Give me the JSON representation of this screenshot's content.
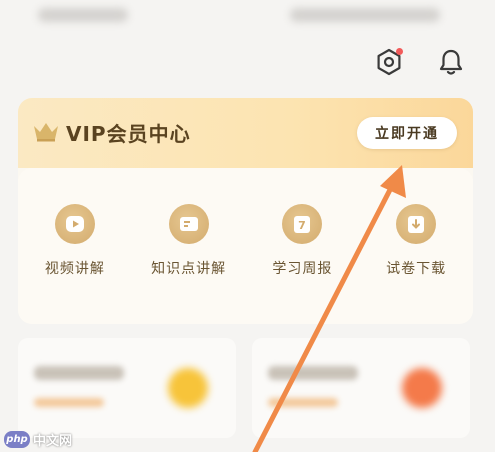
{
  "header": {
    "settings_icon": "settings-hexagon-icon",
    "notification_icon": "bell-icon",
    "accent_dot_color": "#f25a5a"
  },
  "vip": {
    "title": "VIP会员中心",
    "open_button": "立即开通",
    "crown_icon": "crown-icon",
    "header_gradient": [
      "#fbe9c3",
      "#fbd79a"
    ],
    "features": [
      {
        "label": "视频讲解",
        "icon": "play-icon"
      },
      {
        "label": "知识点讲解",
        "icon": "card-list-icon"
      },
      {
        "label": "学习周报",
        "icon": "calendar-7-icon"
      },
      {
        "label": "试卷下载",
        "icon": "download-icon"
      }
    ]
  },
  "annotation": {
    "arrow_color": "#f08a48",
    "pointing_to": "open-vip-button"
  },
  "watermark": {
    "logo": "php",
    "text": "中文网"
  }
}
